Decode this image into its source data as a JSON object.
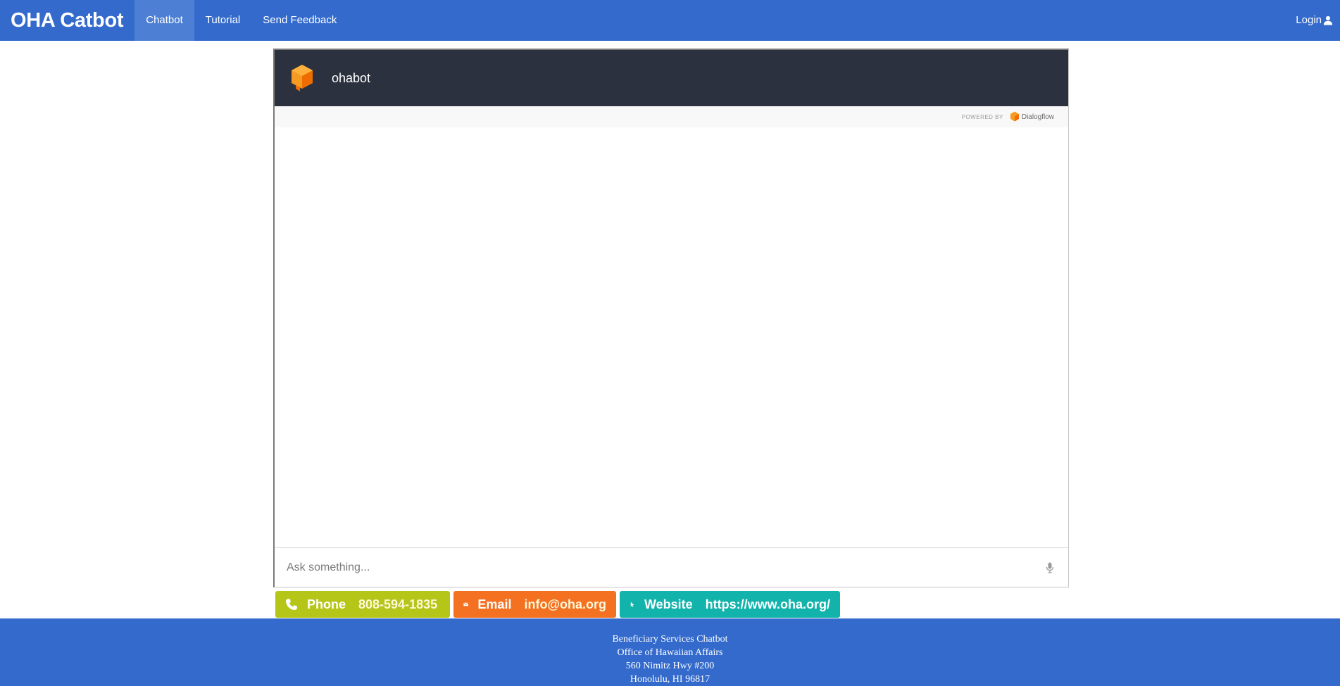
{
  "navbar": {
    "brand": "OHA Catbot",
    "items": [
      {
        "label": "Chatbot",
        "active": true
      },
      {
        "label": "Tutorial",
        "active": false
      },
      {
        "label": "Send Feedback",
        "active": false
      }
    ],
    "login_label": "Login",
    "login_icon": "user-icon",
    "background_color": "#336acc"
  },
  "chat": {
    "bot_name": "ohabot",
    "bot_icon": "dialogflow-cube-icon",
    "powered_by_label": "POWERED BY",
    "powered_by_brand": "Dialogflow",
    "input_placeholder": "Ask something...",
    "mic_icon": "microphone-icon",
    "header_color": "#2b313e"
  },
  "contacts": [
    {
      "icon": "phone-icon",
      "label": "Phone",
      "value": "808-594-1835",
      "color": "#b5c618"
    },
    {
      "icon": "envelope-icon",
      "label": "Email",
      "value": "info@oha.org",
      "color": "#f37121"
    },
    {
      "icon": "cursor-icon",
      "label": "Website",
      "value": "https://www.oha.org/",
      "color": "#12b3aa"
    }
  ],
  "footer": {
    "lines": [
      "Beneficiary Services Chatbot",
      "Office of Hawaiian Affairs",
      "560 Nimitz Hwy #200",
      "Honolulu, HI 96817"
    ]
  }
}
